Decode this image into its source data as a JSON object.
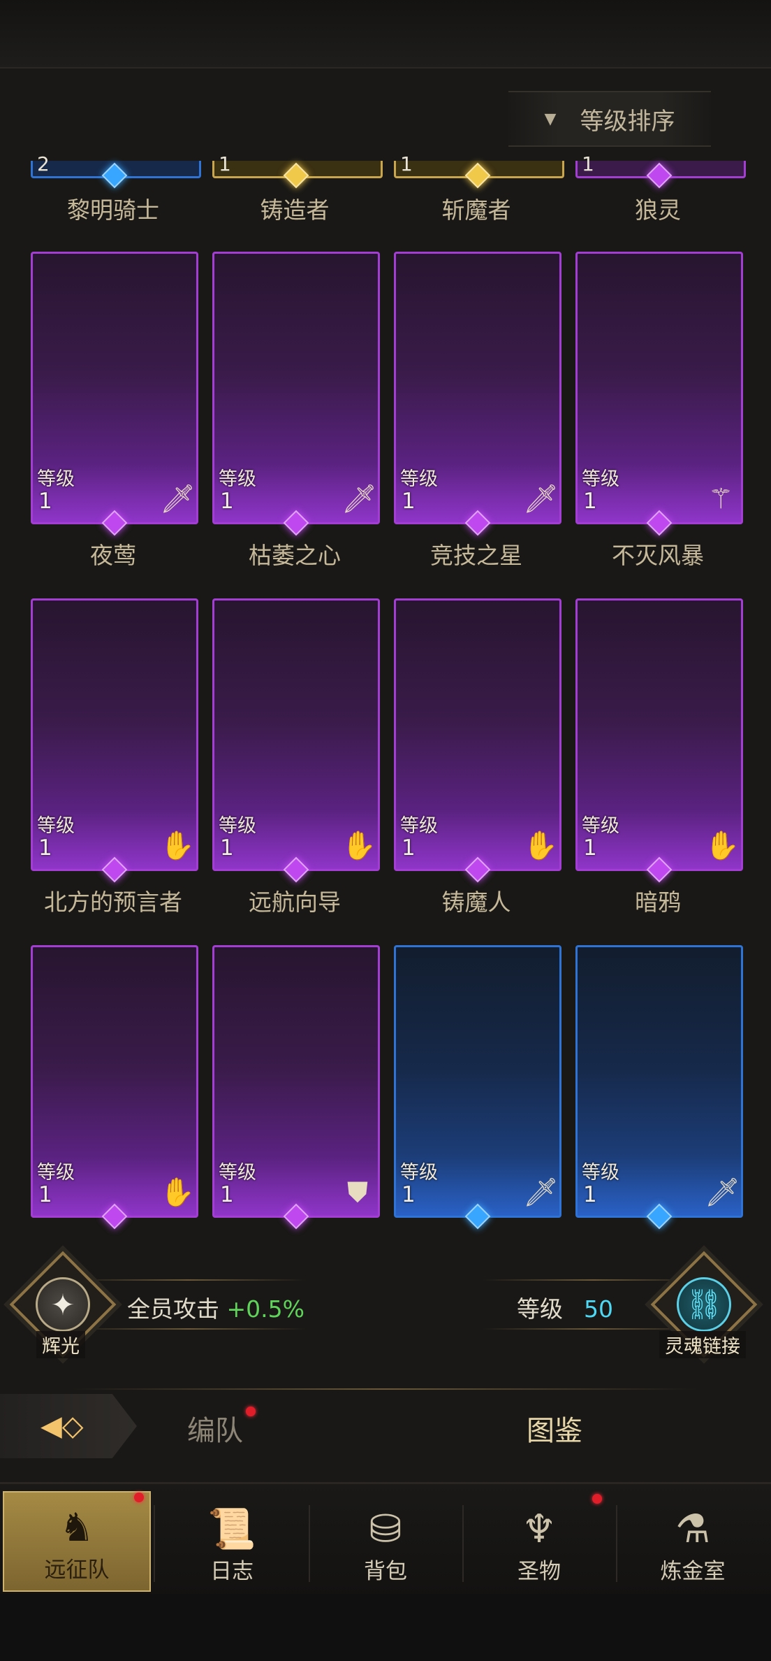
{
  "sort": {
    "label": "等级排序"
  },
  "top_row": [
    {
      "level": "2",
      "name": "黎明骑士",
      "gem": "blue"
    },
    {
      "level": "1",
      "name": "铸造者",
      "gem": "gold"
    },
    {
      "level": "1",
      "name": "斩魔者",
      "gem": "gold"
    },
    {
      "level": "1",
      "name": "狼灵",
      "gem": "purple"
    }
  ],
  "heroes": [
    {
      "name": "夜莺",
      "level_label": "等级",
      "level": "1",
      "class_icon": "sword-icon",
      "rarity": "purple"
    },
    {
      "name": "枯萎之心",
      "level_label": "等级",
      "level": "1",
      "class_icon": "sword-icon",
      "rarity": "purple"
    },
    {
      "name": "竞技之星",
      "level_label": "等级",
      "level": "1",
      "class_icon": "sword-icon",
      "rarity": "purple"
    },
    {
      "name": "不灭风暴",
      "level_label": "等级",
      "level": "1",
      "class_icon": "staff-icon",
      "rarity": "purple"
    },
    {
      "name": "北方的预言者",
      "level_label": "等级",
      "level": "1",
      "class_icon": "hand-icon",
      "rarity": "purple"
    },
    {
      "name": "远航向导",
      "level_label": "等级",
      "level": "1",
      "class_icon": "hand-icon",
      "rarity": "purple"
    },
    {
      "name": "铸魔人",
      "level_label": "等级",
      "level": "1",
      "class_icon": "hand-icon",
      "rarity": "purple"
    },
    {
      "name": "暗鸦",
      "level_label": "等级",
      "level": "1",
      "class_icon": "hand-icon",
      "rarity": "purple"
    },
    {
      "name": "",
      "level_label": "等级",
      "level": "1",
      "class_icon": "hand-icon",
      "rarity": "purple"
    },
    {
      "name": "",
      "level_label": "等级",
      "level": "1",
      "class_icon": "shield-icon",
      "rarity": "purple"
    },
    {
      "name": "",
      "level_label": "等级",
      "level": "1",
      "class_icon": "sword-icon",
      "rarity": "blue"
    },
    {
      "name": "",
      "level_label": "等级",
      "level": "1",
      "class_icon": "sword-icon",
      "rarity": "blue"
    }
  ],
  "bonus": {
    "radiance_label": "辉光",
    "attack_text": "全员攻击",
    "attack_value": "+0.5%",
    "level_label": "等级",
    "level_value": "50",
    "soul_link_label": "灵魂链接"
  },
  "subtabs": {
    "team": "编队",
    "codex": "图鉴"
  },
  "nav": [
    {
      "label": "远征队",
      "icon": "viking-helmet-icon",
      "active": true
    },
    {
      "label": "日志",
      "icon": "scroll-icon",
      "active": false
    },
    {
      "label": "背包",
      "icon": "bag-icon",
      "active": false
    },
    {
      "label": "圣物",
      "icon": "chalice-icon",
      "active": false
    },
    {
      "label": "炼金室",
      "icon": "alchemy-icon",
      "active": false
    }
  ],
  "colors": {
    "purple_frame": "#a33ed2",
    "blue_frame": "#2f74d4",
    "gold": "#c9a64d",
    "green_value": "#5fd35a",
    "cyan_value": "#4fd8f3"
  }
}
